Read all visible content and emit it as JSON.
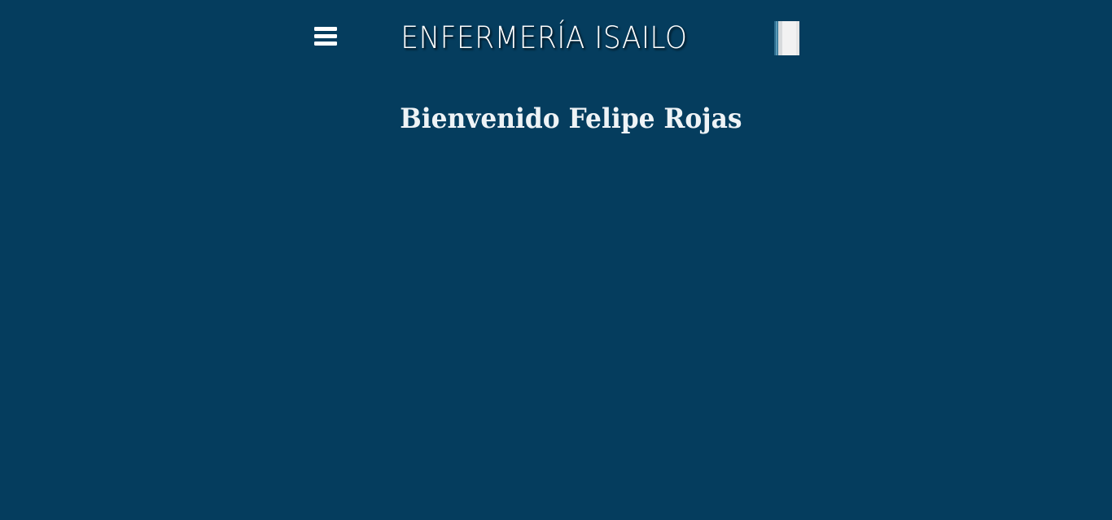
{
  "header": {
    "menu_icon": "hamburger-menu-icon",
    "title": "ENFERMERÍA ISAILO",
    "book_icon": "open-book-icon"
  },
  "main": {
    "welcome_text": "Bienvenido Felipe Rojas"
  },
  "colors": {
    "background": "#053d5e",
    "text": "#ffffff"
  }
}
